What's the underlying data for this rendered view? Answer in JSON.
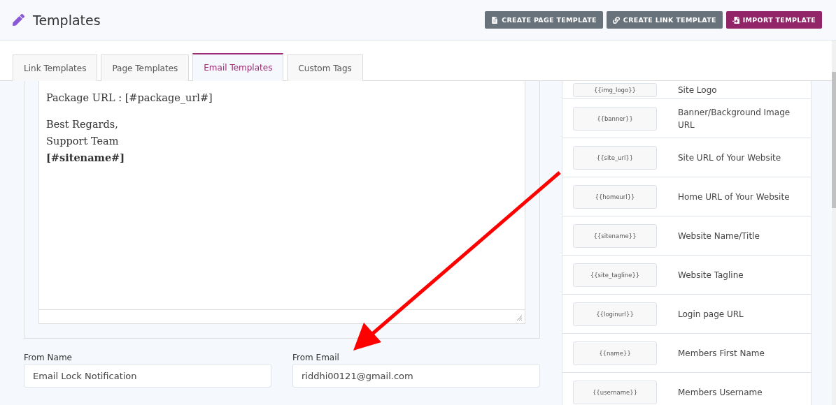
{
  "header": {
    "title": "Templates",
    "buttons": [
      {
        "kind": "page",
        "label": "CREATE PAGE TEMPLATE"
      },
      {
        "kind": "link",
        "label": "CREATE LINK TEMPLATE"
      },
      {
        "kind": "import",
        "label": "IMPORT TEMPLATE"
      }
    ]
  },
  "tabs": [
    {
      "label": "Link Templates",
      "selected": false
    },
    {
      "label": "Page Templates",
      "selected": false
    },
    {
      "label": "Email Templates",
      "selected": true
    },
    {
      "label": "Custom Tags",
      "selected": false
    }
  ],
  "editor": {
    "lines": [
      {
        "kind": "para",
        "text": "Package URL : [#package_url#]"
      },
      {
        "kind": "line",
        "text": "Best Regards,"
      },
      {
        "kind": "line",
        "text": "Support Team"
      },
      {
        "kind": "bold",
        "text": "[#sitename#]"
      }
    ]
  },
  "fields": [
    {
      "label": "From Name",
      "value": "Email Lock Notification"
    },
    {
      "label": "From Email",
      "value": "riddhi00121@gmail.com"
    }
  ],
  "tags": [
    {
      "tag": "{{img_logo}}",
      "description": "Site Logo"
    },
    {
      "tag": "{{banner}}",
      "description": "Banner/Background Image URL"
    },
    {
      "tag": "{{site_url}}",
      "description": "Site URL of Your Website"
    },
    {
      "tag": "{{homeurl}}",
      "description": "Home URL of Your Website"
    },
    {
      "tag": "{{sitename}}",
      "description": "Website Name/Title"
    },
    {
      "tag": "{{site_tagline}}",
      "description": "Website Tagline"
    },
    {
      "tag": "{{loginurl}}",
      "description": "Login page URL"
    },
    {
      "tag": "{{name}}",
      "description": "Members First Name"
    },
    {
      "tag": "{{username}}",
      "description": "Members Username"
    }
  ]
}
